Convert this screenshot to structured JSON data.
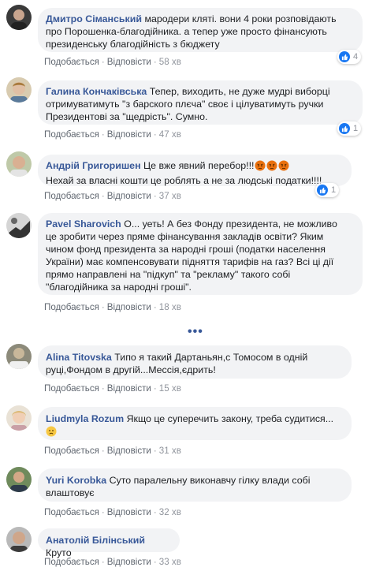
{
  "comments": [
    {
      "author": "Дмитро Сіманський",
      "lines": [
        "мародери кляті. вони 4 роки розповідають",
        "про Порошенка-благодійника. а тепер уже просто фінансують",
        "президенську благодійність з бюджету"
      ],
      "like_label": "Подобається",
      "reply_label": "Відповісти",
      "time": "58 хв",
      "reactions": "4"
    },
    {
      "author": "Галина Кончаківська",
      "lines": [
        "Тепер, виходить, не дуже мудрі виборці",
        "отримуватимуть \"з барского плєча\" своє і цілуватимуть ручки",
        "Президентові за \"щедрість\". Сумно."
      ],
      "like_label": "Подобається",
      "reply_label": "Відповісти",
      "time": "47 хв",
      "reactions": "1"
    },
    {
      "author": "Андрій Григоришен",
      "lines": [
        "Це вже явний перебор!!!",
        "Нехай за власні кошти це роблять а не за людські податки!!!!"
      ],
      "like_label": "Подобається",
      "reply_label": "Відповісти",
      "time": "37 хв",
      "reactions": "1"
    },
    {
      "author": "Pavel Sharovich",
      "lines": [
        "О... уеть! А без Фонду президента, не можливо",
        "це зробити через пряме фінансування закладів освіти? Яким",
        "чином фонд президента за народні гроші (податки населення",
        "України) має компенсовувати підняття тарифів на газ? Всі ці дії",
        "прямо направлені на \"підкуп\" та \"рекламу\" такого собі",
        "\"благодійника за народні гроші\"."
      ],
      "like_label": "Подобається",
      "reply_label": "Відповісти",
      "time": "18 хв"
    },
    {
      "author": "Alina Titovska",
      "lines": [
        "Типо я такий Дартаньян,с Томосом в одній",
        "руці,Фондом в другій...Мессія,єдрить!"
      ],
      "like_label": "Подобається",
      "reply_label": "Відповісти",
      "time": "15 хв"
    },
    {
      "author": "Liudmyla Rozum",
      "lines": [
        "Якщо це суперечить закону, треба судитися...",
        ""
      ],
      "like_label": "Подобається",
      "reply_label": "Відповісти",
      "time": "31 хв"
    },
    {
      "author": "Yuri Korobka",
      "lines": [
        "Суто паралельну виконавчу гілку влади собі",
        "влаштовує"
      ],
      "like_label": "Подобається",
      "reply_label": "Відповісти",
      "time": "32 хв"
    },
    {
      "author": "Анатолій Білінський",
      "lines": [
        "Круто"
      ],
      "like_label": "Подобається",
      "reply_label": "Відповісти",
      "time": "33 хв"
    }
  ],
  "more_label": "•••",
  "colors": {
    "author": "#385898",
    "bubble": "#f2f3f5",
    "meta": "#90949c",
    "like": "#1877f2",
    "angry": "#e9710f"
  }
}
